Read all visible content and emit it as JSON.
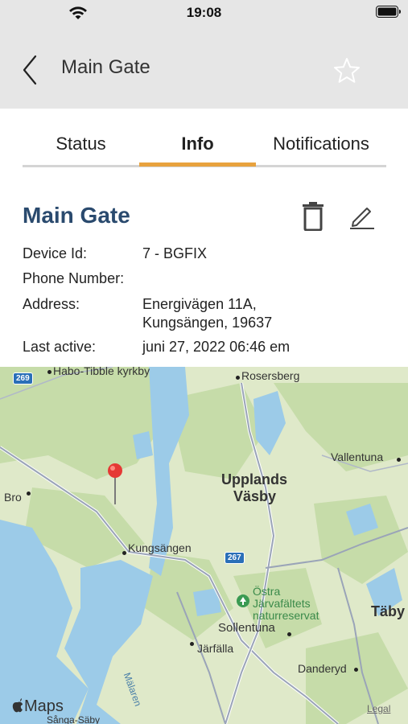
{
  "status_bar": {
    "time": "19:08"
  },
  "nav": {
    "title": "Main Gate"
  },
  "tabs": [
    {
      "label": "Status"
    },
    {
      "label": "Info"
    },
    {
      "label": "Notifications"
    }
  ],
  "colors": {
    "tab_accent": "#e8a23e",
    "title_blue": "#2a4a6e",
    "header_bg": "#e6e6e6",
    "pin_red": "#e53935"
  },
  "device": {
    "name": "Main Gate",
    "fields": [
      {
        "label": "Device Id:",
        "value": "7 - BGFIX"
      },
      {
        "label": "Phone Number:",
        "value": ""
      },
      {
        "label": "Address:",
        "value_line1": "Energivägen 11A,",
        "value_line2": "Kungsängen, 19637"
      },
      {
        "label": "Last active:",
        "value": "juni 27, 2022 06:46 em"
      }
    ]
  },
  "map": {
    "labels": {
      "habo": "Habo-Tibble kyrkby",
      "rosersberg": "Rosersberg",
      "vallentuna": "Vallentuna",
      "bro": "Bro",
      "upplands1": "Upplands",
      "upplands2": "Väsby",
      "kungsangen": "Kungsängen",
      "ostra1": "Östra",
      "ostra2": "Järvafältets",
      "ostra3": "naturreservat",
      "taby": "Täby",
      "sollentuna": "Sollentuna",
      "jarfalla": "Järfälla",
      "danderyd": "Danderyd",
      "malaren": "Mälaren",
      "sanga": "Sånga-Säby"
    },
    "road_badges": {
      "r269": "269",
      "r267": "267"
    },
    "attribution": "Maps",
    "legal": "Legal"
  },
  "icons": [
    "wifi-icon",
    "battery-icon",
    "back-chevron-icon",
    "star-icon",
    "trash-icon",
    "pencil-icon",
    "map-pin-icon",
    "apple-icon",
    "park-icon"
  ]
}
